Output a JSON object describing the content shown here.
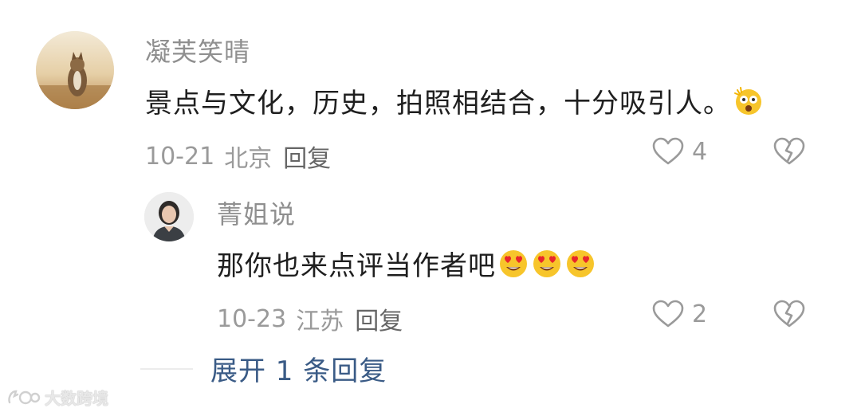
{
  "comment": {
    "username": "凝芙笑晴",
    "text": "景点与文化，历史，拍照相结合，十分吸引人。",
    "emoji": "astonished-face-emoji",
    "date": "10-21",
    "location": "北京",
    "reply_label": "回复",
    "like_count": "4"
  },
  "reply": {
    "username": "菁姐说",
    "text": "那你也来点评当作者吧",
    "emojis": [
      "heart-eyes-emoji",
      "heart-eyes-emoji",
      "heart-eyes-emoji"
    ],
    "date": "10-23",
    "location": "江苏",
    "reply_label": "回复",
    "like_count": "2"
  },
  "expand_replies": "展开 1 条回复",
  "watermark": "大数跨境",
  "colors": {
    "username": "#8f8f8f",
    "meta": "#9a9a9a",
    "link": "#3a5b86",
    "text": "#1f1f1f"
  }
}
